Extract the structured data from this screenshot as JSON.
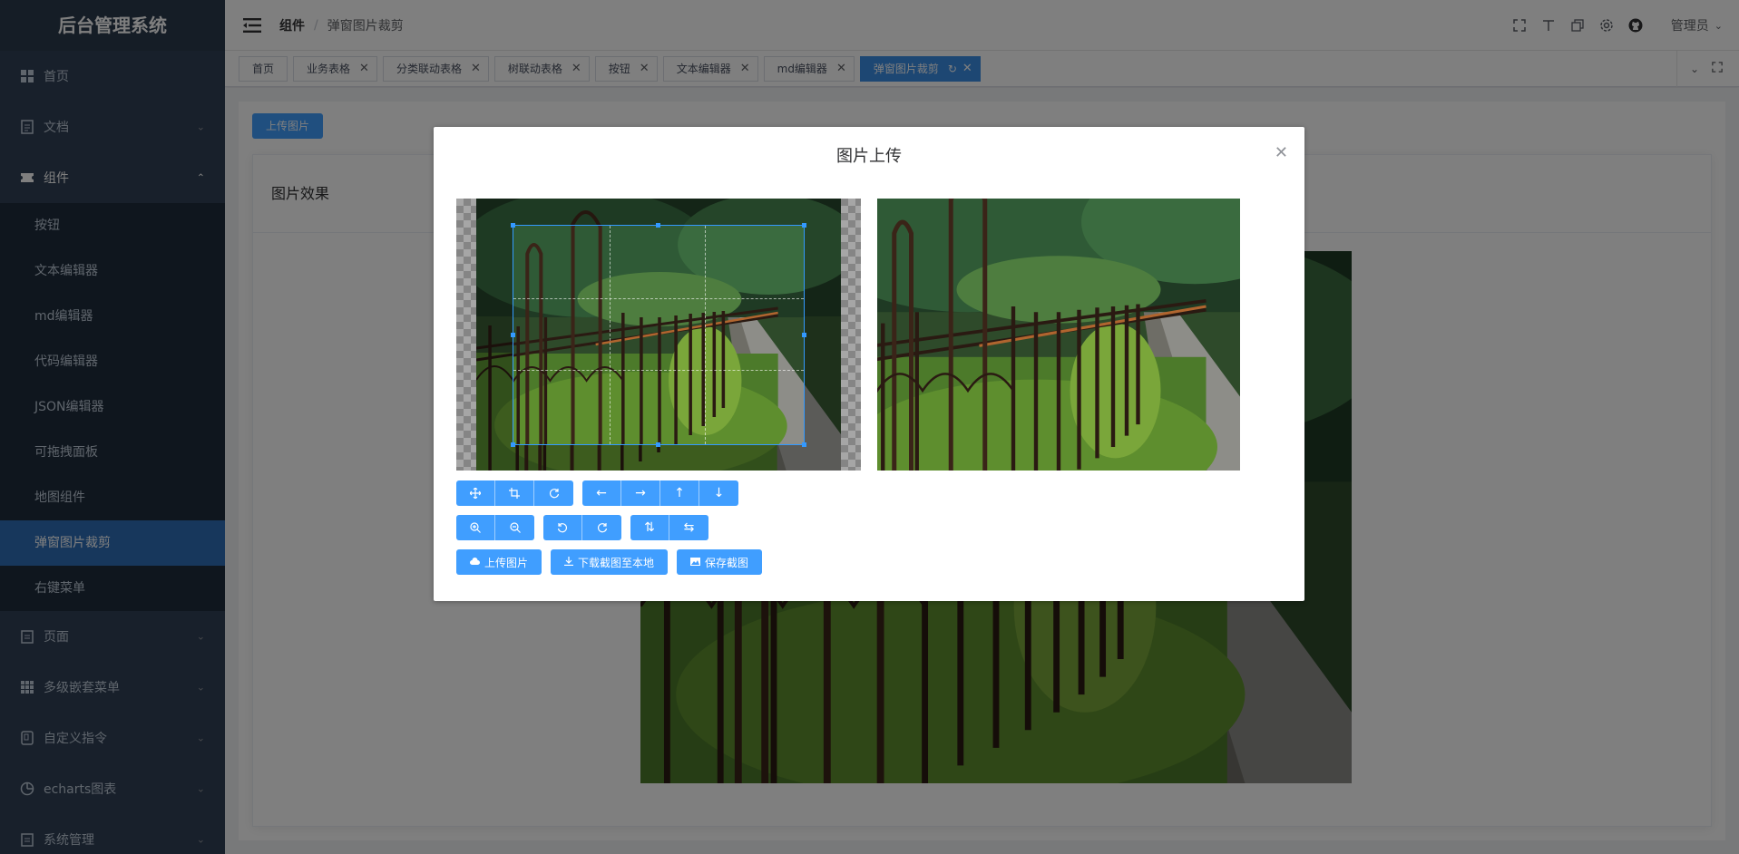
{
  "app": {
    "title": "后台管理系统"
  },
  "sidebar": {
    "items": [
      {
        "label": "首页",
        "icon": "dashboard-icon"
      },
      {
        "label": "文档",
        "icon": "document-icon"
      },
      {
        "label": "组件",
        "icon": "ticket-icon"
      },
      {
        "label": "页面",
        "icon": "page-icon"
      },
      {
        "label": "多级嵌套菜单",
        "icon": "grid-icon"
      },
      {
        "label": "自定义指令",
        "icon": "directive-icon"
      },
      {
        "label": "echarts图表",
        "icon": "chart-icon"
      },
      {
        "label": "系统管理",
        "icon": "system-icon"
      }
    ],
    "sub_items": [
      "按钮",
      "文本编辑器",
      "md编辑器",
      "代码编辑器",
      "JSON编辑器",
      "可拖拽面板",
      "地图组件",
      "弹窗图片裁剪",
      "右键菜单"
    ],
    "active_sub": "弹窗图片裁剪",
    "active_color": "#2f6fb8"
  },
  "breadcrumb": {
    "parent": "组件",
    "current": "弹窗图片裁剪"
  },
  "header": {
    "user": "管理员"
  },
  "tags": [
    {
      "label": "首页"
    },
    {
      "label": "业务表格"
    },
    {
      "label": "分类联动表格"
    },
    {
      "label": "树联动表格"
    },
    {
      "label": "按钮"
    },
    {
      "label": "文本编辑器"
    },
    {
      "label": "md编辑器"
    },
    {
      "label": "弹窗图片裁剪"
    }
  ],
  "main": {
    "upload_button": "上传图片",
    "card_title": "图片效果"
  },
  "dialog": {
    "title": "图片上传",
    "buttons": {
      "upload": "上传图片",
      "download": "下载截图至本地",
      "save": "保存截图"
    }
  },
  "colors": {
    "primary": "#409eff",
    "sidebar": "#304156"
  }
}
